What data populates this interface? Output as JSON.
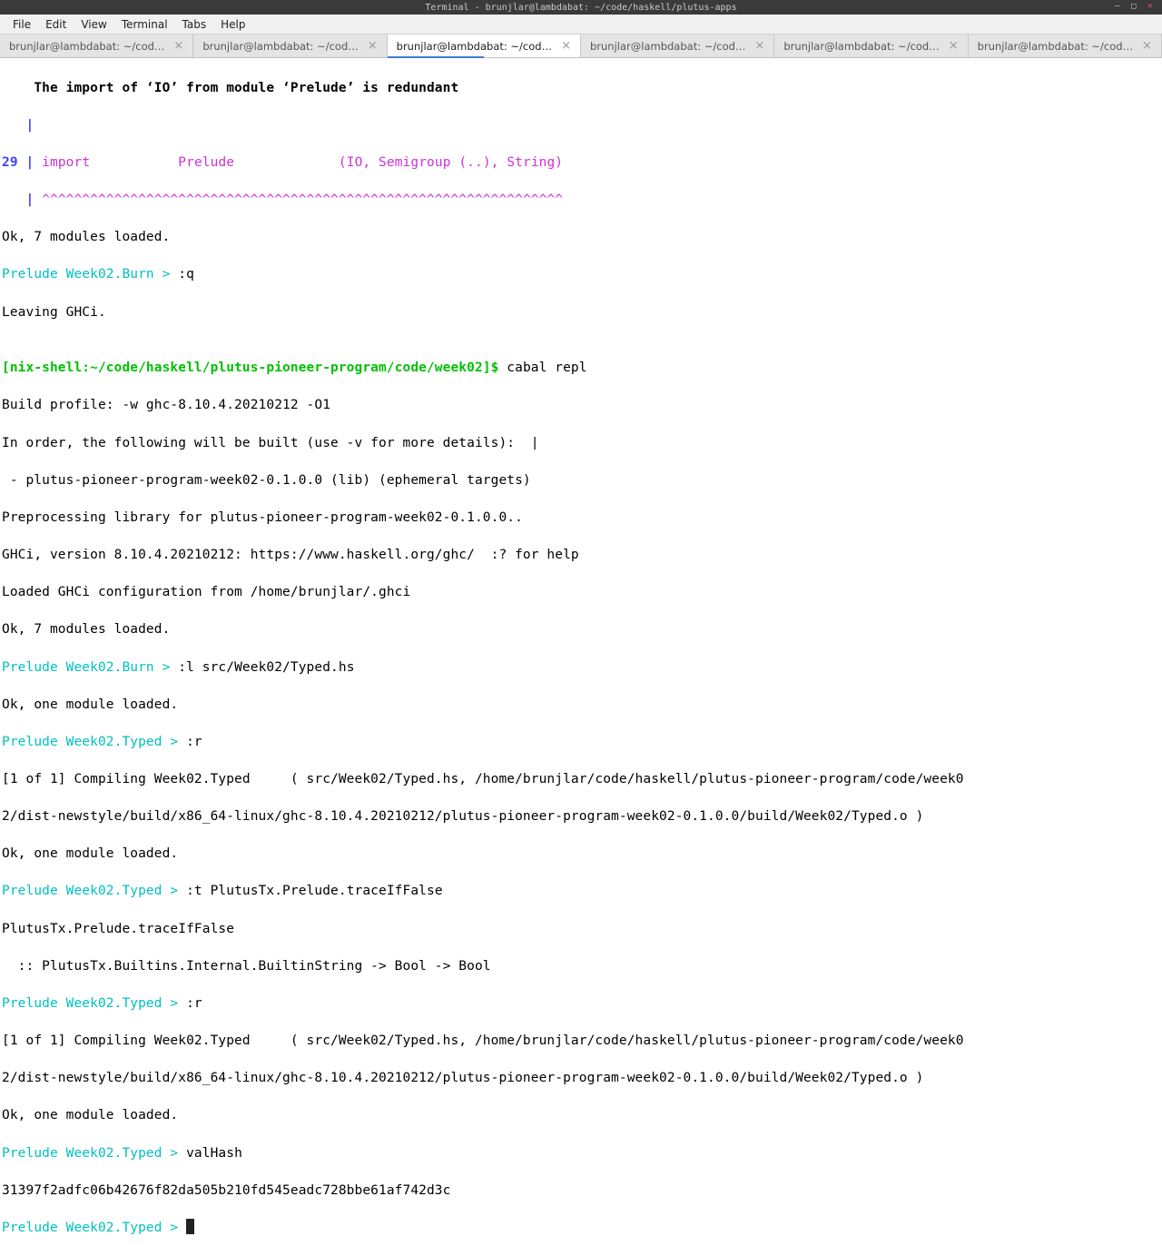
{
  "titlebar": {
    "title": "Terminal - brunjlar@lambdabat: ~/code/haskell/plutus-apps"
  },
  "menu": {
    "file": "File",
    "edit": "Edit",
    "view": "View",
    "terminal": "Terminal",
    "tabs": "Tabs",
    "help": "Help"
  },
  "tabs": [
    {
      "label": "brunjlar@lambdabat: ~/code/haskell/pl...",
      "active": false
    },
    {
      "label": "brunjlar@lambdabat: ~/code/haskell/pl...",
      "active": false
    },
    {
      "label": "brunjlar@lambdabat: ~/code/haskell/pl...",
      "active": true
    },
    {
      "label": "brunjlar@lambdabat: ~/code/haskell/pl...",
      "active": false
    },
    {
      "label": "brunjlar@lambdabat: ~/code/haskell/pl...",
      "active": false
    },
    {
      "label": "brunjlar@lambdabat: ~/code/haskell/pl...",
      "active": false
    }
  ],
  "term": {
    "warn1": "    The import of ‘IO’ from module ‘Prelude’ is redundant",
    "pipe1": "   |",
    "lineno": "29",
    "pipe2": " | ",
    "import_kw": "import",
    "import_sp": "           ",
    "import_mod": "Prelude",
    "import_sp2": "             ",
    "import_rest": "(IO, Semigroup (..), String)",
    "pipe3": "   | ",
    "carets": "^^^^^^^^^^^^^^^^^^^^^^^^^^^^^^^^^^^^^^^^^^^^^^^^^^^^^^^^^^^^^^^^^",
    "ok1": "Ok, 7 modules loaded.",
    "prompt_burn1": "Prelude Week02.Burn > ",
    "cmd_q": ":q",
    "leave": "Leaving GHCi.",
    "blank": "",
    "shell_prompt": "[nix-shell:~/code/haskell/plutus-pioneer-program/code/week02]$",
    "cmd_cabal": " cabal repl",
    "build_profile": "Build profile: -w ghc-8.10.4.20210212 -O1",
    "inorder": "In order, the following will be built (use -v for more details):",
    "text_cursor_mark": "  |",
    "target": " - plutus-pioneer-program-week02-0.1.0.0 (lib) (ephemeral targets)",
    "preproc": "Preprocessing library for plutus-pioneer-program-week02-0.1.0.0..",
    "ghci_ver": "GHCi, version 8.10.4.20210212: https://www.haskell.org/ghc/  :? for help",
    "loaded_conf": "Loaded GHCi configuration from /home/brunjlar/.ghci",
    "ok2": "Ok, 7 modules loaded.",
    "prompt_burn2": "Prelude Week02.Burn > ",
    "cmd_l": ":l src/Week02/Typed.hs",
    "ok3": "Ok, one module loaded.",
    "prompt_typed1": "Prelude Week02.Typed > ",
    "cmd_r1": ":r",
    "compile1": "[1 of 1] Compiling Week02.Typed     ( src/Week02/Typed.hs, /home/brunjlar/code/haskell/plutus-pioneer-program/code/week0",
    "compile1b": "2/dist-newstyle/build/x86_64-linux/ghc-8.10.4.20210212/plutus-pioneer-program-week02-0.1.0.0/build/Week02/Typed.o )",
    "ok4": "Ok, one module loaded.",
    "prompt_typed2": "Prelude Week02.Typed > ",
    "cmd_t": ":t PlutusTx.Prelude.traceIfFalse",
    "trace1": "PlutusTx.Prelude.traceIfFalse",
    "trace2": "  :: PlutusTx.Builtins.Internal.BuiltinString -> Bool -> Bool",
    "prompt_typed3": "Prelude Week02.Typed > ",
    "cmd_r2": ":r",
    "compile2": "[1 of 1] Compiling Week02.Typed     ( src/Week02/Typed.hs, /home/brunjlar/code/haskell/plutus-pioneer-program/code/week0",
    "compile2b": "2/dist-newstyle/build/x86_64-linux/ghc-8.10.4.20210212/plutus-pioneer-program-week02-0.1.0.0/build/Week02/Typed.o )",
    "ok5": "Ok, one module loaded.",
    "prompt_typed4": "Prelude Week02.Typed > ",
    "cmd_valhash": "valHash",
    "hash": "31397f2adfc06b42676f82da505b210fd545eadc728bbe61af742d3c",
    "prompt_typed5": "Prelude Week02.Typed > "
  }
}
